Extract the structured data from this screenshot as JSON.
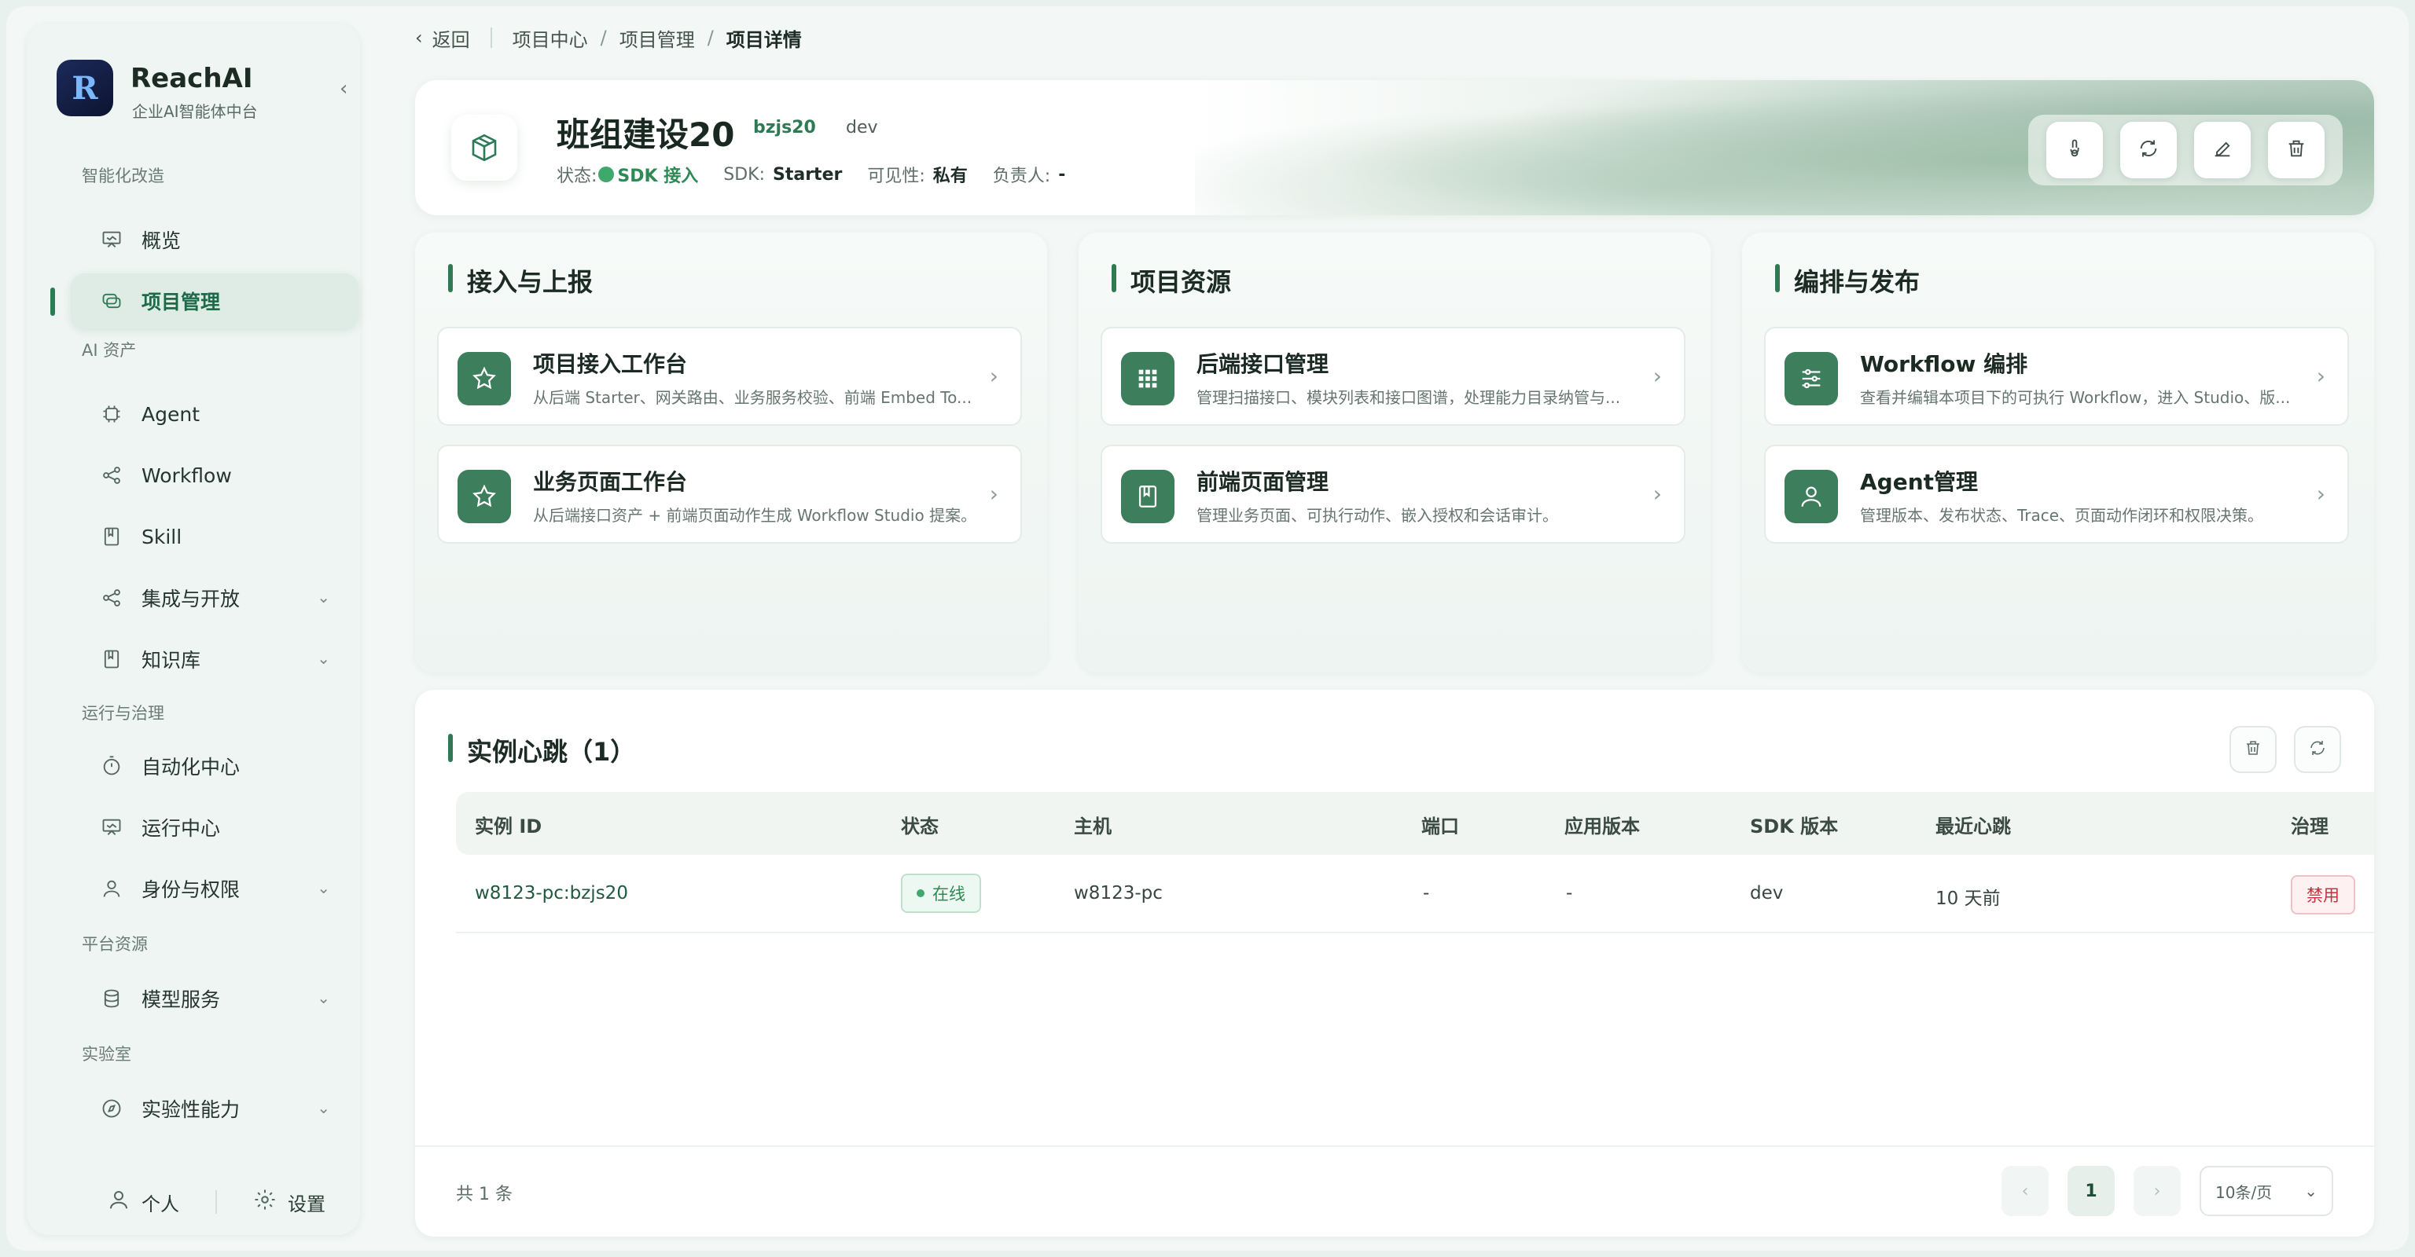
{
  "brand": {
    "name": "ReachAI",
    "subtitle": "企业AI智能体中台",
    "logo_letter": "R"
  },
  "sidebar": {
    "sections": [
      {
        "label": "智能化改造"
      },
      {
        "label": "AI 资产"
      },
      {
        "label": "运行与治理"
      },
      {
        "label": "平台资源"
      },
      {
        "label": "实验室"
      }
    ],
    "items": [
      {
        "label": "概览",
        "icon": "presentation-icon"
      },
      {
        "label": "项目管理",
        "icon": "layers-icon",
        "active": true
      },
      {
        "label": "Agent",
        "icon": "chip-icon"
      },
      {
        "label": "Workflow",
        "icon": "share-icon"
      },
      {
        "label": "Skill",
        "icon": "book-icon"
      },
      {
        "label": "集成与开放",
        "icon": "share-icon",
        "expandable": true
      },
      {
        "label": "知识库",
        "icon": "book-icon",
        "expandable": true
      },
      {
        "label": "自动化中心",
        "icon": "timer-icon"
      },
      {
        "label": "运行中心",
        "icon": "presentation-icon"
      },
      {
        "label": "身份与权限",
        "icon": "user-icon",
        "expandable": true
      },
      {
        "label": "模型服务",
        "icon": "database-icon",
        "expandable": true
      },
      {
        "label": "实验性能力",
        "icon": "compass-icon",
        "expandable": true
      }
    ],
    "footer": {
      "personal": "个人",
      "settings": "设置"
    }
  },
  "topbar": {
    "back": "返回",
    "breadcrumb": [
      "项目中心",
      "项目管理",
      "项目详情"
    ]
  },
  "project": {
    "title": "班组建设20",
    "code": "bzjs20",
    "env": "dev",
    "status_label": "状态:",
    "status_value": "SDK 接入",
    "sdk_label": "SDK:",
    "sdk_value": "Starter",
    "visibility_label": "可见性:",
    "visibility_value": "私有",
    "owner_label": "负责人:",
    "owner_value": "-"
  },
  "cards": [
    {
      "title": "接入与上报",
      "entries": [
        {
          "title": "项目接入工作台",
          "desc": "从后端 Starter、网关路由、业务服务校验、前端 Embed To...",
          "icon": "star-icon"
        },
        {
          "title": "业务页面工作台",
          "desc": "从后端接口资产 + 前端页面动作生成 Workflow Studio 提案。",
          "icon": "star-icon"
        }
      ]
    },
    {
      "title": "项目资源",
      "entries": [
        {
          "title": "后端接口管理",
          "desc": "管理扫描接口、模块列表和接口图谱，处理能力目录纳管与...",
          "icon": "grid-icon"
        },
        {
          "title": "前端页面管理",
          "desc": "管理业务页面、可执行动作、嵌入授权和会话审计。",
          "icon": "book-icon"
        }
      ]
    },
    {
      "title": "编排与发布",
      "entries": [
        {
          "title": "Workflow 编排",
          "desc": "查看并编辑本项目下的可执行 Workflow，进入 Studio、版...",
          "icon": "sliders-icon"
        },
        {
          "title": "Agent管理",
          "desc": "管理版本、发布状态、Trace、页面动作闭环和权限决策。",
          "icon": "user-icon"
        }
      ]
    }
  ],
  "heartbeat": {
    "title": "实例心跳（1）",
    "columns": [
      "实例 ID",
      "状态",
      "主机",
      "端口",
      "应用版本",
      "SDK 版本",
      "最近心跳",
      "治理"
    ],
    "rows": [
      {
        "id": "w8123-pc:bzjs20",
        "status": "在线",
        "host": "w8123-pc",
        "port": "-",
        "app_version": "-",
        "sdk_version": "dev",
        "last_beat": "10 天前",
        "action": "禁用"
      }
    ],
    "total": "共 1 条",
    "page": "1",
    "page_size": "10条/页"
  },
  "colors": {
    "accent": "#2e7a55",
    "online": "#3fa86c",
    "danger": "#c4323f"
  }
}
